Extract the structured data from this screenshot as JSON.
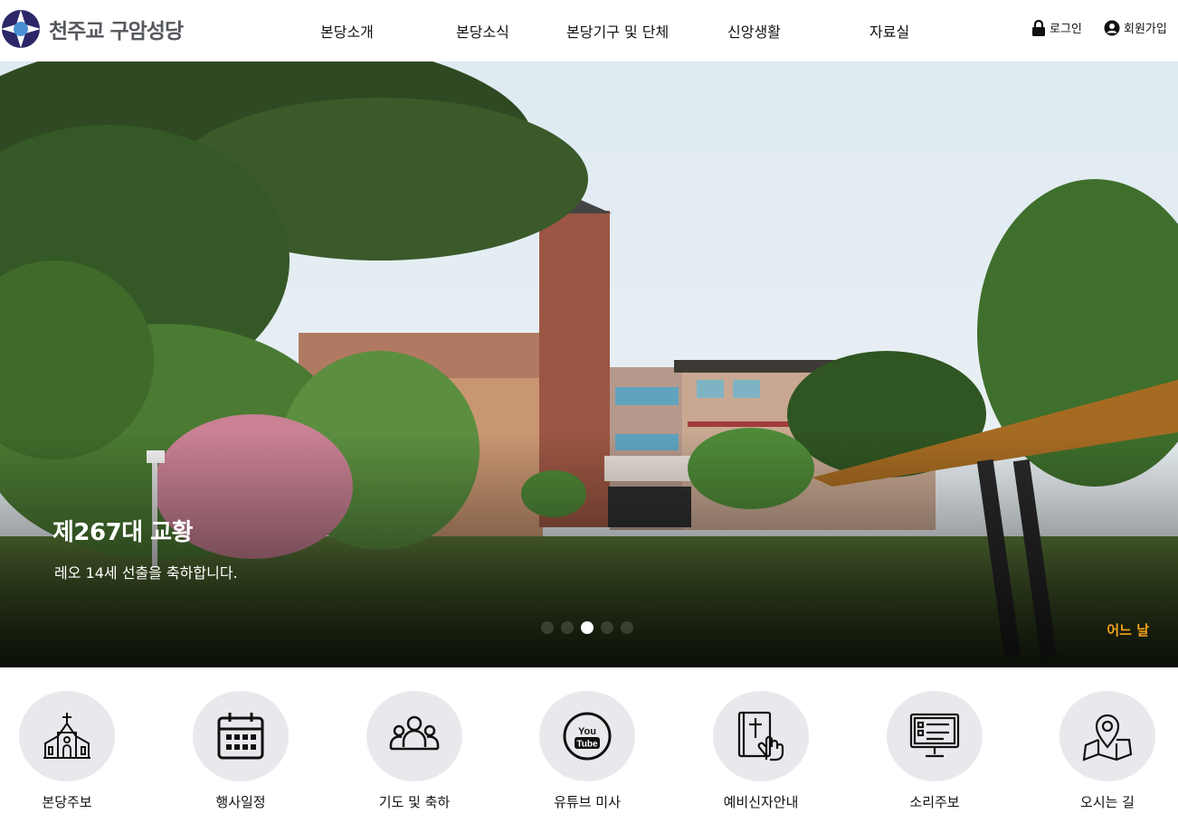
{
  "site": {
    "name": "천주교 구암성당",
    "colors": {
      "brand_navy": "#2c2768",
      "brand_blue": "#4a8fd4",
      "accent_orange": "#f2a21a"
    }
  },
  "nav": {
    "items": [
      {
        "label": "본당소개"
      },
      {
        "label": "본당소식"
      },
      {
        "label": "본당기구 및 단체"
      },
      {
        "label": "신앙생활"
      },
      {
        "label": "자료실"
      }
    ]
  },
  "util": {
    "login": {
      "label": "로그인",
      "icon": "lock-icon"
    },
    "signup": {
      "label": "회원가입",
      "icon": "user-circle-icon"
    }
  },
  "hero": {
    "title": "제267대 교황",
    "subtitle": "레오 14세 선출을 축하합니다.",
    "tag": "어느 날",
    "slides": 5,
    "active_slide": 3
  },
  "quick_menu": [
    {
      "label": "본당주보",
      "icon": "church-icon"
    },
    {
      "label": "행사일정",
      "icon": "calendar-icon"
    },
    {
      "label": "기도 및 축하",
      "icon": "people-icon"
    },
    {
      "label": "유튜브 미사",
      "icon": "youtube-icon"
    },
    {
      "label": "예비신자안내",
      "icon": "bible-icon"
    },
    {
      "label": "소리주보",
      "icon": "monitor-icon"
    },
    {
      "label": "오시는 길",
      "icon": "map-pin-icon"
    }
  ]
}
